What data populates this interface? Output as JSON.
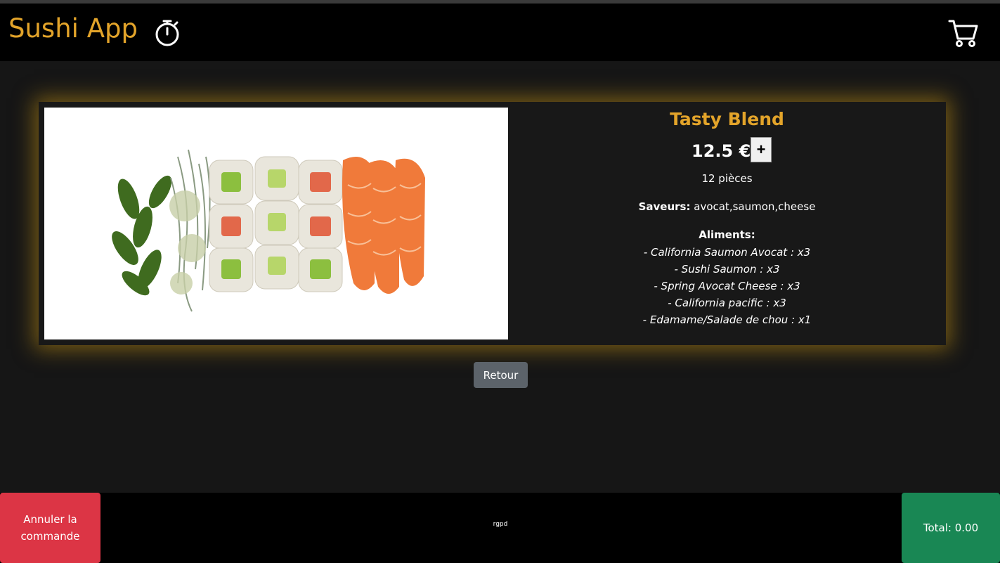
{
  "header": {
    "brand": "Sushi App",
    "timer_icon": "stopwatch-icon",
    "cart_icon": "cart-icon"
  },
  "product": {
    "name": "Tasty Blend",
    "price": "12.5 €",
    "add_label": "+",
    "pieces": "12 pièces",
    "flavors_label": "Saveurs:",
    "flavors": "avocat,saumon,cheese",
    "aliments_label": "Aliments:",
    "aliments": [
      "- California Saumon Avocat : x3",
      "- Sushi Saumon : x3",
      "- Spring Avocat Cheese : x3",
      "- California pacific : x3",
      "- Edamame/Salade de chou : x1"
    ]
  },
  "back_label": "Retour",
  "footer": {
    "cancel_label": "Annuler la commande",
    "rgpd_label": "rgpd",
    "total_label": "Total: 0.00"
  },
  "colors": {
    "accent": "#e3a42a",
    "danger": "#dc3545",
    "success": "#198754",
    "secondary": "#5c636a"
  }
}
